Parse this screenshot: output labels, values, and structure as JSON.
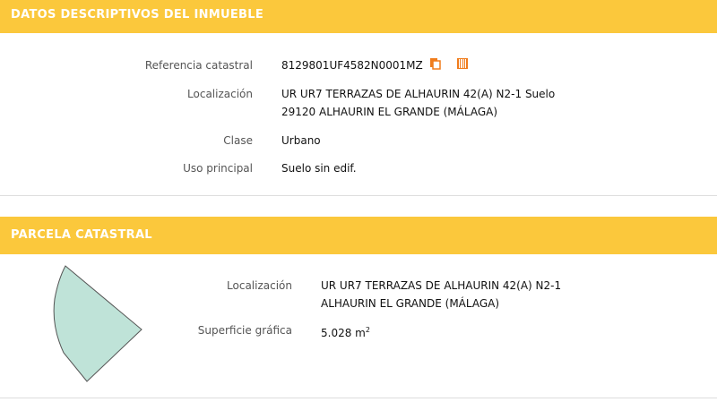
{
  "inmueble": {
    "title": "DATOS DESCRIPTIVOS DEL INMUEBLE",
    "ref_label": "Referencia catastral",
    "ref_value": "8129801UF4582N0001MZ",
    "loc_label": "Localización",
    "loc_line1": "UR UR7 TERRAZAS DE ALHAURIN 42(A) N2-1 Suelo",
    "loc_line2": "29120 ALHAURIN EL GRANDE (MÁLAGA)",
    "clase_label": "Clase",
    "clase_value": "Urbano",
    "uso_label": "Uso principal",
    "uso_value": "Suelo sin edif."
  },
  "parcela": {
    "title": "PARCELA CATASTRAL",
    "loc_label": "Localización",
    "loc_line1": "UR UR7 TERRAZAS DE ALHAURIN 42(A) N2-1",
    "loc_line2": "ALHAURIN EL GRANDE (MÁLAGA)",
    "sup_label": "Superficie gráfica",
    "sup_value": "5.028 m",
    "sup_unit_sup": "2"
  },
  "colors": {
    "header_bg": "#fbc83c",
    "icon_orange": "#f07c1c",
    "parcel_fill": "#bfe3d8"
  },
  "icons": {
    "copy": "copy-icon",
    "barcode": "barcode-icon"
  }
}
